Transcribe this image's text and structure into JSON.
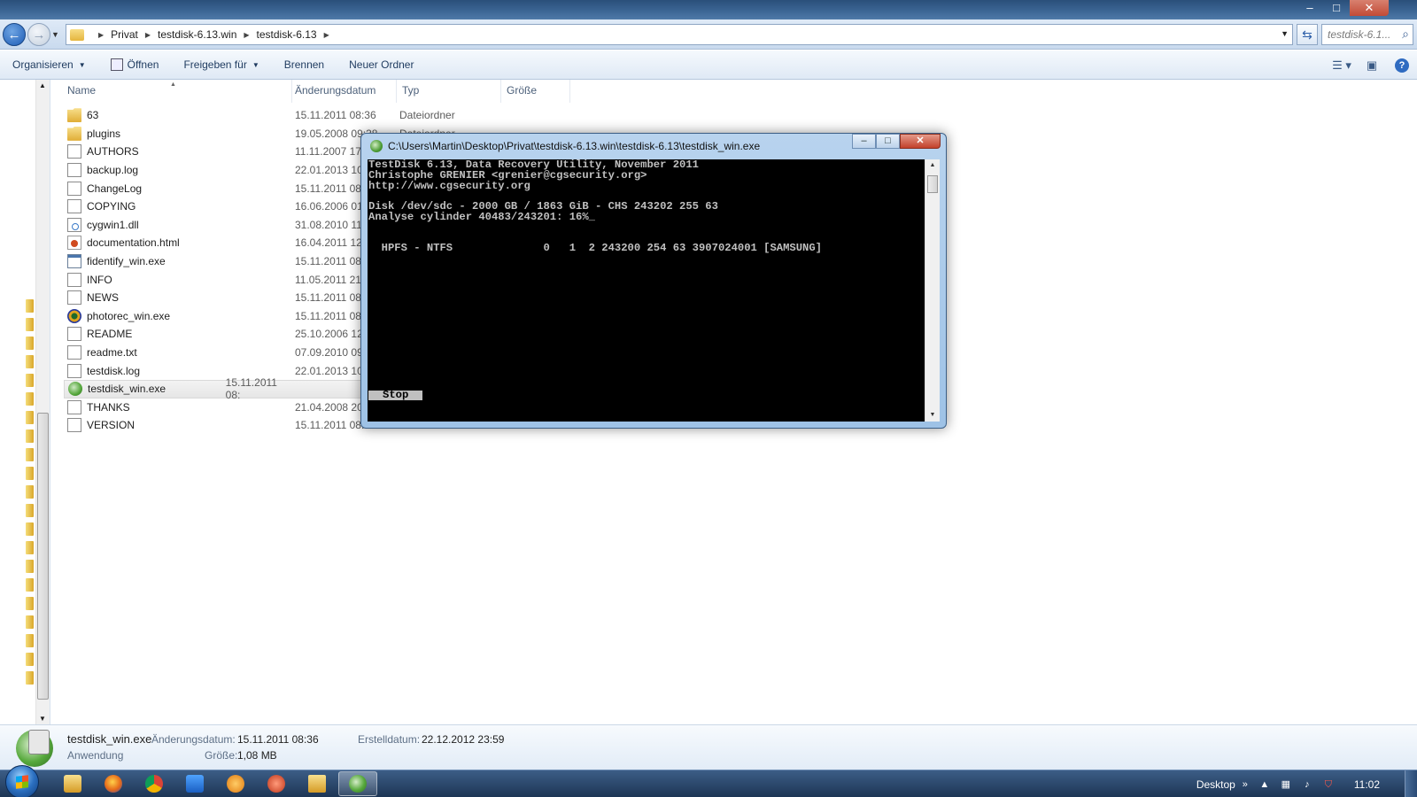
{
  "explorer": {
    "title_controls": {
      "minimize": "–",
      "maximize": "□",
      "close": "✕"
    },
    "address": {
      "crumbs": [
        "Privat",
        "testdisk-6.13.win",
        "testdisk-6.13"
      ],
      "search_placeholder": "testdisk-6.1..."
    },
    "toolbar": {
      "organize": "Organisieren",
      "open": "Öffnen",
      "share": "Freigeben für",
      "burn": "Brennen",
      "new_folder": "Neuer Ordner"
    },
    "columns": {
      "name": "Name",
      "date": "Änderungsdatum",
      "type": "Typ",
      "size": "Größe"
    },
    "files": [
      {
        "name": "63",
        "date": "15.11.2011 08:36",
        "type": "Dateiordner",
        "icon": "folder"
      },
      {
        "name": "plugins",
        "date": "19.05.2008 09:38",
        "type": "Dateiordner",
        "icon": "folder"
      },
      {
        "name": "AUTHORS",
        "date": "11.11.2007 17:2",
        "type": "",
        "icon": "file"
      },
      {
        "name": "backup.log",
        "date": "22.01.2013 10:",
        "type": "",
        "icon": "file"
      },
      {
        "name": "ChangeLog",
        "date": "15.11.2011 08:",
        "type": "",
        "icon": "file"
      },
      {
        "name": "COPYING",
        "date": "16.06.2006 01:0",
        "type": "",
        "icon": "file"
      },
      {
        "name": "cygwin1.dll",
        "date": "31.08.2010 11:",
        "type": "",
        "icon": "dll"
      },
      {
        "name": "documentation.html",
        "date": "16.04.2011 12:",
        "type": "",
        "icon": "html"
      },
      {
        "name": "fidentify_win.exe",
        "date": "15.11.2011 08:",
        "type": "",
        "icon": "exe"
      },
      {
        "name": "INFO",
        "date": "11.05.2011 21:5",
        "type": "",
        "icon": "file"
      },
      {
        "name": "NEWS",
        "date": "15.11.2011 08:0",
        "type": "",
        "icon": "file"
      },
      {
        "name": "photorec_win.exe",
        "date": "15.11.2011 08:",
        "type": "",
        "icon": "photorec"
      },
      {
        "name": "README",
        "date": "25.10.2006 12:4",
        "type": "",
        "icon": "file"
      },
      {
        "name": "readme.txt",
        "date": "07.09.2010 09:4",
        "type": "",
        "icon": "file"
      },
      {
        "name": "testdisk.log",
        "date": "22.01.2013 10:",
        "type": "",
        "icon": "file"
      },
      {
        "name": "testdisk_win.exe",
        "date": "15.11.2011 08:",
        "type": "",
        "icon": "testdisk",
        "selected": true
      },
      {
        "name": "THANKS",
        "date": "21.04.2008 20:",
        "type": "",
        "icon": "file"
      },
      {
        "name": "VERSION",
        "date": "15.11.2011 08:",
        "type": "",
        "icon": "file"
      }
    ],
    "details": {
      "filename": "testdisk_win.exe",
      "kind": "Anwendung",
      "modified_label": "Änderungsdatum:",
      "modified_value": "15.11.2011 08:36",
      "size_label": "Größe:",
      "size_value": "1,08 MB",
      "created_label": "Erstelldatum:",
      "created_value": "22.12.2012 23:59"
    }
  },
  "console": {
    "title": "C:\\Users\\Martin\\Desktop\\Privat\\testdisk-6.13.win\\testdisk-6.13\\testdisk_win.exe",
    "lines": [
      "TestDisk 6.13, Data Recovery Utility, November 2011",
      "Christophe GRENIER <grenier@cgsecurity.org>",
      "http://www.cgsecurity.org",
      "",
      "Disk /dev/sdc - 2000 GB / 1863 GiB - CHS 243202 255 63",
      "Analyse cylinder 40483/243201: 16%_",
      "",
      "",
      "  HPFS - NTFS              0   1  2 243200 254 63 3907024001 [SAMSUNG]"
    ],
    "stop_label": "Stop"
  },
  "taskbar": {
    "desktop_label": "Desktop",
    "clock": "11:02"
  }
}
